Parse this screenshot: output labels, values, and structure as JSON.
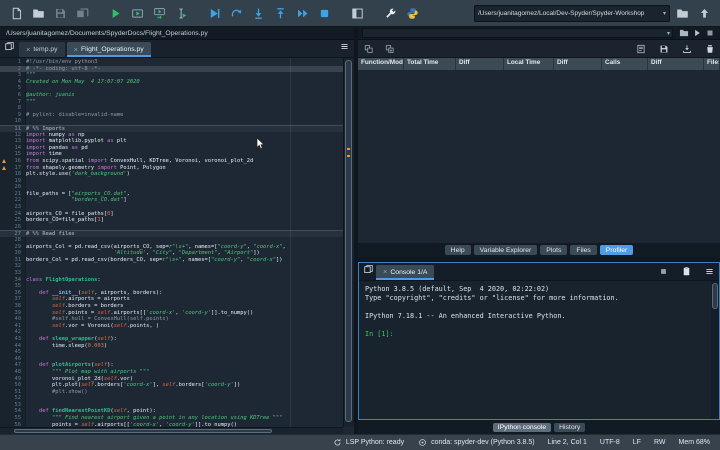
{
  "toolbar": {
    "file_icons": [
      "new-file",
      "open-file",
      "save-file",
      "save-all"
    ],
    "run_icons": [
      "run-file",
      "run-cell",
      "run-cell-and-advance",
      "run-selection"
    ],
    "debug_icons": [
      "debug-file",
      "run-current-line",
      "step-into",
      "step-out",
      "continue-execution",
      "stop-debugging"
    ],
    "pane_icons": [
      "maximize-pane"
    ],
    "pref_icons": [
      "preferences"
    ],
    "python_icons": [
      "python-path-manager"
    ],
    "cwd": "/Users/juanitagomez/Local/Dev-Spyder/Spyder-Workshop",
    "cwd_icons": [
      "open-directory",
      "parent-directory"
    ]
  },
  "editor": {
    "path": "/Users/juanitagomez/Documents/SpyderDocs/Flight_Operations.py",
    "tabbar_left_icons": [
      "browse-tabs"
    ],
    "tabbar_right_icons": [
      "options-menu"
    ],
    "tabs": [
      {
        "label": "temp.py",
        "active": false
      },
      {
        "label": "Flight_Operations.py",
        "active": true
      }
    ],
    "lines": [
      [
        "",
        [
          [
            "c",
            "#!/usr/bin/env python3"
          ]
        ]
      ],
      [
        "hl",
        [
          [
            "c",
            "# -*- coding: utf-8 -*-"
          ]
        ]
      ],
      [
        "",
        [
          [
            "s",
            "\"\"\""
          ]
        ]
      ],
      [
        "",
        [
          [
            "s",
            "Created on Mon May  4 17:07:07 2020"
          ]
        ]
      ],
      [
        "",
        []
      ],
      [
        "",
        [
          [
            "s",
            "@author: juanis"
          ]
        ]
      ],
      [
        "",
        [
          [
            "s",
            "\"\"\""
          ]
        ]
      ],
      [
        "",
        []
      ],
      [
        "",
        [
          [
            "c",
            "# pylint: disable=invalid-name"
          ]
        ]
      ],
      [
        "",
        []
      ],
      [
        "cell",
        [
          [
            "c",
            "# %% Imports"
          ]
        ]
      ],
      [
        "",
        [
          [
            "k",
            "import"
          ],
          [
            "t",
            " numpy "
          ],
          [
            "k",
            "as"
          ],
          [
            "t",
            " np"
          ]
        ]
      ],
      [
        "",
        [
          [
            "k",
            "import"
          ],
          [
            "t",
            " matplotlib.pyplot "
          ],
          [
            "k",
            "as"
          ],
          [
            "t",
            " plt"
          ]
        ]
      ],
      [
        "",
        [
          [
            "k",
            "import"
          ],
          [
            "t",
            " pandas "
          ],
          [
            "k",
            "as"
          ],
          [
            "t",
            " pd"
          ]
        ]
      ],
      [
        "",
        [
          [
            "k",
            "import"
          ],
          [
            "t",
            " time"
          ]
        ]
      ],
      [
        "warn",
        [
          [
            "k",
            "from"
          ],
          [
            "t",
            " scipy.spatial "
          ],
          [
            "k",
            "import"
          ],
          [
            "t",
            " ConvexHull, KDTree, Voronoi, voronoi_plot_2d"
          ]
        ]
      ],
      [
        "warn",
        [
          [
            "k",
            "from"
          ],
          [
            "t",
            " shapely.geometry "
          ],
          [
            "k",
            "import"
          ],
          [
            "t",
            " Point, Polygon"
          ]
        ]
      ],
      [
        "",
        [
          [
            "t",
            "plt.style.use("
          ],
          [
            "s",
            "'dark_background'"
          ],
          [
            "t",
            ")"
          ]
        ]
      ],
      [
        "",
        []
      ],
      [
        "",
        []
      ],
      [
        "",
        [
          [
            "t",
            "file_paths = ["
          ],
          [
            "s",
            "\"airports_CO.dat\""
          ],
          [
            "t",
            ","
          ]
        ]
      ],
      [
        "",
        [
          [
            "t",
            "              "
          ],
          [
            "s",
            "\"borders_CO.dat\""
          ],
          [
            "t",
            "]"
          ]
        ]
      ],
      [
        "",
        []
      ],
      [
        "",
        [
          [
            "t",
            "airports_CO = file_paths["
          ],
          [
            "n",
            "0"
          ],
          [
            "t",
            "]"
          ]
        ]
      ],
      [
        "",
        [
          [
            "t",
            "borders_CO=file_paths["
          ],
          [
            "n",
            "1"
          ],
          [
            "t",
            "]"
          ]
        ]
      ],
      [
        "",
        []
      ],
      [
        "cell",
        [
          [
            "c",
            "# %% Read files"
          ]
        ]
      ],
      [
        "",
        []
      ],
      [
        "",
        [
          [
            "t",
            "airports_Col = pd.read_csv(airports_CO, sep="
          ],
          [
            "s",
            "r\"\\s+\""
          ],
          [
            "t",
            ", names=["
          ],
          [
            "s",
            "\"coord-y\""
          ],
          [
            "t",
            ", "
          ],
          [
            "s",
            "\"coord-x\""
          ],
          [
            "t",
            ","
          ]
        ]
      ],
      [
        "",
        [
          [
            "t",
            "                           "
          ],
          [
            "s",
            "'Altitude'"
          ],
          [
            "t",
            ", "
          ],
          [
            "s",
            "\"City\""
          ],
          [
            "t",
            ", "
          ],
          [
            "s",
            "\"Department\""
          ],
          [
            "t",
            ", "
          ],
          [
            "s",
            "\"Airport\""
          ],
          [
            "t",
            "])"
          ]
        ]
      ],
      [
        "",
        [
          [
            "t",
            "borders_Col = pd.read_csv(borders_CO, sep="
          ],
          [
            "s",
            "r\"\\s+\""
          ],
          [
            "t",
            ", names=["
          ],
          [
            "s",
            "\"coord-y\""
          ],
          [
            "t",
            ", "
          ],
          [
            "s",
            "\"coord-x\""
          ],
          [
            "t",
            "])"
          ]
        ]
      ],
      [
        "",
        []
      ],
      [
        "",
        []
      ],
      [
        "",
        [
          [
            "k",
            "class"
          ],
          [
            "t",
            " "
          ],
          [
            "d",
            "FlightOperations"
          ],
          [
            "t",
            ":"
          ]
        ]
      ],
      [
        "",
        []
      ],
      [
        "",
        [
          [
            "t",
            "    "
          ],
          [
            "k",
            "def"
          ],
          [
            "t",
            " "
          ],
          [
            "m",
            "__init__"
          ],
          [
            "t",
            "("
          ],
          [
            "se",
            "self"
          ],
          [
            "t",
            ", airports, borders):"
          ]
        ]
      ],
      [
        "",
        [
          [
            "t",
            "        "
          ],
          [
            "se",
            "self"
          ],
          [
            "t",
            ".airports = airports"
          ]
        ]
      ],
      [
        "",
        [
          [
            "t",
            "        "
          ],
          [
            "se",
            "self"
          ],
          [
            "t",
            ".borders = borders"
          ]
        ]
      ],
      [
        "",
        [
          [
            "t",
            "        "
          ],
          [
            "se",
            "self"
          ],
          [
            "t",
            ".points = "
          ],
          [
            "se",
            "self"
          ],
          [
            "t",
            ".airports[["
          ],
          [
            "s",
            "'coord-x'"
          ],
          [
            "t",
            ", "
          ],
          [
            "s",
            "'coord-y'"
          ],
          [
            "t",
            "]].to_numpy()"
          ]
        ]
      ],
      [
        "",
        [
          [
            "c",
            "        #self.hull = ConvexHull(self.points)"
          ]
        ]
      ],
      [
        "",
        [
          [
            "t",
            "        "
          ],
          [
            "se",
            "self"
          ],
          [
            "t",
            ".vor = Voronoi("
          ],
          [
            "se",
            "self"
          ],
          [
            "t",
            ".points, )"
          ]
        ]
      ],
      [
        "",
        []
      ],
      [
        "",
        [
          [
            "t",
            "    "
          ],
          [
            "k",
            "def"
          ],
          [
            "t",
            " "
          ],
          [
            "d",
            "sleep_wrapper"
          ],
          [
            "t",
            "("
          ],
          [
            "se",
            "self"
          ],
          [
            "t",
            "):"
          ]
        ]
      ],
      [
        "",
        [
          [
            "t",
            "        time.sleep("
          ],
          [
            "n",
            "0.003"
          ],
          [
            "t",
            ")"
          ]
        ]
      ],
      [
        "",
        []
      ],
      [
        "",
        []
      ],
      [
        "",
        [
          [
            "t",
            "    "
          ],
          [
            "k",
            "def"
          ],
          [
            "t",
            " "
          ],
          [
            "d",
            "plotAirports"
          ],
          [
            "t",
            "("
          ],
          [
            "se",
            "self"
          ],
          [
            "t",
            "):"
          ]
        ]
      ],
      [
        "",
        [
          [
            "t",
            "        "
          ],
          [
            "s",
            "\"\"\" Plot map with airports \"\"\""
          ]
        ]
      ],
      [
        "",
        [
          [
            "t",
            "        voronoi_plot_2d("
          ],
          [
            "se",
            "self"
          ],
          [
            "t",
            ".vor)"
          ]
        ]
      ],
      [
        "",
        [
          [
            "t",
            "        plt.plot("
          ],
          [
            "se",
            "self"
          ],
          [
            "t",
            ".borders["
          ],
          [
            "s",
            "'coord-x'"
          ],
          [
            "t",
            "], "
          ],
          [
            "se",
            "self"
          ],
          [
            "t",
            ".borders["
          ],
          [
            "s",
            "'coord-y'"
          ],
          [
            "t",
            "])"
          ]
        ]
      ],
      [
        "",
        [
          [
            "c",
            "        #plt.show()"
          ]
        ]
      ],
      [
        "",
        []
      ],
      [
        "",
        []
      ],
      [
        "",
        [
          [
            "t",
            "    "
          ],
          [
            "k",
            "def"
          ],
          [
            "t",
            " "
          ],
          [
            "d",
            "findNearestPointKD"
          ],
          [
            "t",
            "("
          ],
          [
            "se",
            "self"
          ],
          [
            "t",
            ", point):"
          ]
        ]
      ],
      [
        "",
        [
          [
            "t",
            "        "
          ],
          [
            "s",
            "\"\"\" Find nearest airport given a point in any location using KDTree \"\"\""
          ]
        ]
      ],
      [
        "",
        [
          [
            "t",
            "        points = "
          ],
          [
            "se",
            "self"
          ],
          [
            "t",
            ".airports[["
          ],
          [
            "s",
            "'coord-x'"
          ],
          [
            "t",
            ", "
          ],
          [
            "s",
            "'coord-y'"
          ],
          [
            "t",
            "]].to_numpy()"
          ]
        ]
      ]
    ]
  },
  "profiler": {
    "row1_icons": [
      "select-script",
      "run-profiler",
      "stop-profiler"
    ],
    "toolbar_left_icons": [
      "collapse-one-level",
      "expand-one-level"
    ],
    "toolbar_right_icons": [
      "show-output",
      "save-data",
      "load-data",
      "clear-comparison"
    ],
    "columns": [
      "Function/Modu",
      "Total Time",
      "Diff",
      "Local Time",
      "Diff",
      "Calls",
      "Diff",
      "File:"
    ]
  },
  "right_tabs": [
    {
      "label": "Help",
      "active": false
    },
    {
      "label": "Variable Explorer",
      "active": false
    },
    {
      "label": "Plots",
      "active": false
    },
    {
      "label": "Files",
      "active": false
    },
    {
      "label": "Profiler",
      "active": true
    }
  ],
  "console": {
    "tabbar_left_icons": [
      "browse-tabs"
    ],
    "tabbar_right_icons": [
      "interrupt-kernel",
      "inspect-object",
      "options-menu"
    ],
    "tab": "Console 1/A",
    "lines": [
      "Python 3.8.5 (default, Sep  4 2020, 02:22:02)",
      "Type \"copyright\", \"credits\" or \"license\" for more information.",
      "",
      "IPython 7.18.1 -- An enhanced Interactive Python.",
      ""
    ],
    "prompt": "In [1]:",
    "bottom_tabs": [
      {
        "label": "IPython console",
        "active": true
      },
      {
        "label": "History",
        "active": false
      }
    ]
  },
  "statusbar": {
    "items": [
      {
        "icon": "lsp-status",
        "label": "LSP Python: ready",
        "clickable": true
      },
      {
        "icon": "conda-env",
        "label": "conda: spyder-dev (Python 3.8.5)",
        "clickable": true
      },
      {
        "label": "Line 2, Col 1",
        "clickable": false
      },
      {
        "label": "UTF-8",
        "clickable": false
      },
      {
        "label": "LF",
        "clickable": false
      },
      {
        "label": "RW",
        "clickable": false
      },
      {
        "label": "Mem 68%",
        "clickable": false
      }
    ]
  },
  "colors": {
    "accent_blue": "#4f9be4",
    "run_green": "#2fbe66",
    "debug_blue": "#3ea2e5",
    "warning_orange": "#e2973a"
  }
}
